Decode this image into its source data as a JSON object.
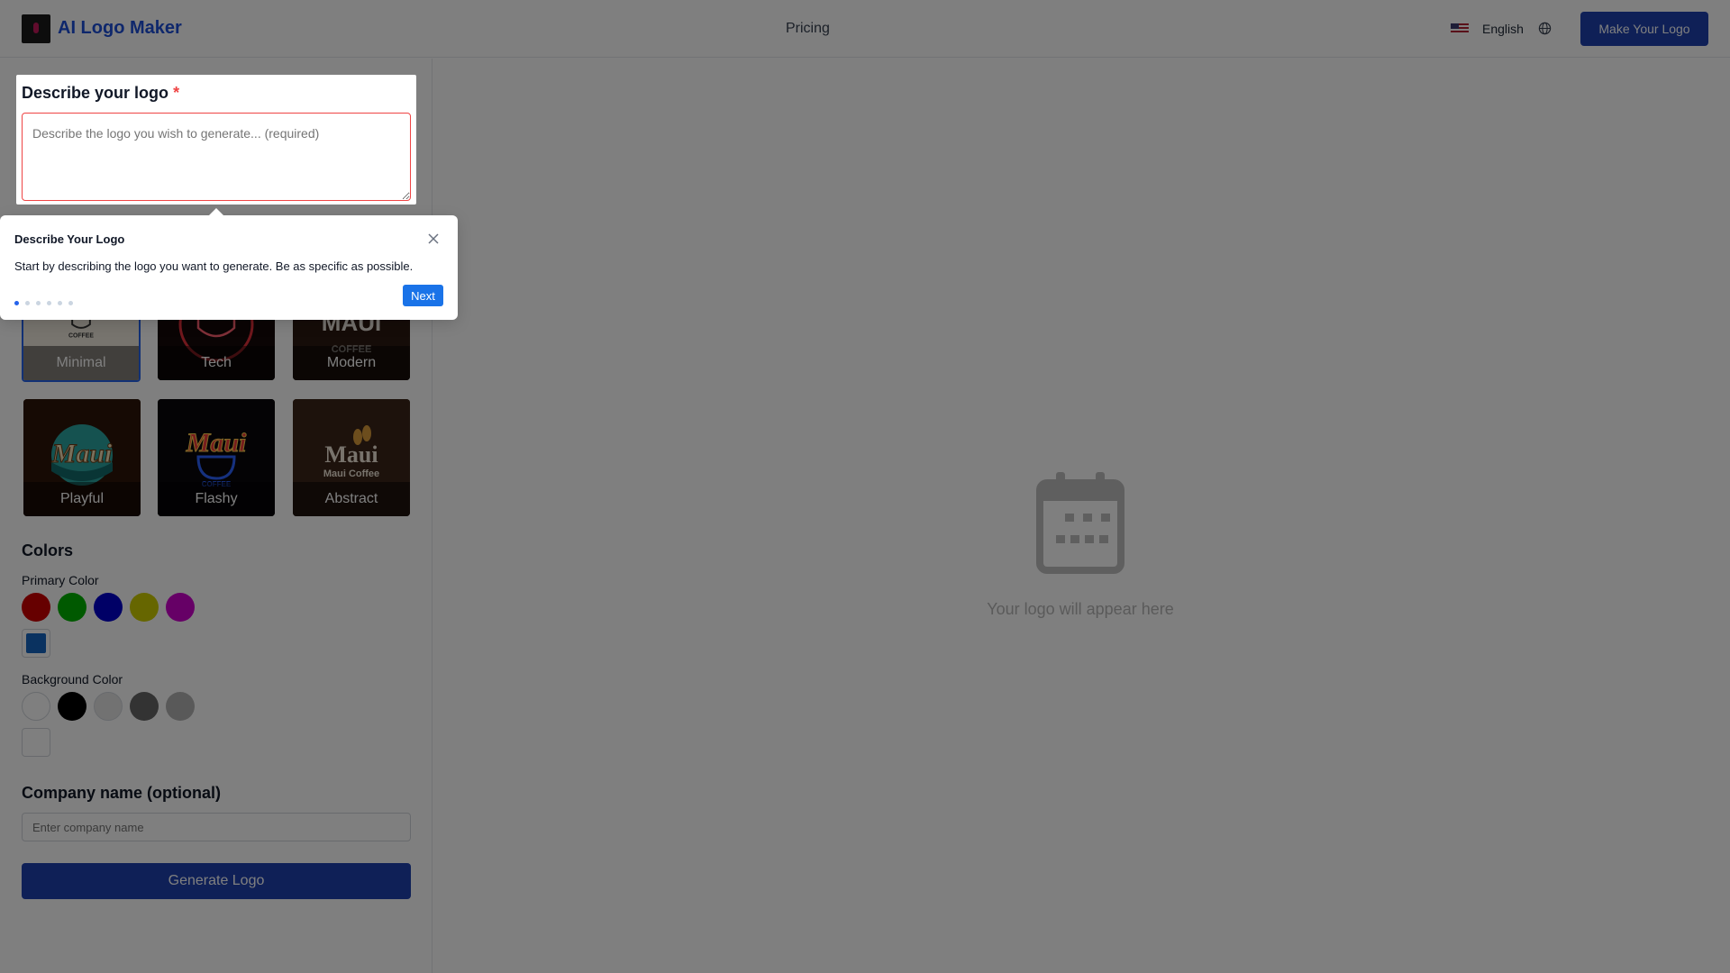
{
  "header": {
    "brand": "AI Logo Maker",
    "nav_pricing": "Pricing",
    "language": "English",
    "make_logo_button": "Make Your Logo"
  },
  "describe": {
    "title": "Describe your logo",
    "required_mark": "*",
    "placeholder": "Describe the logo you wish to generate... (required)"
  },
  "styles": {
    "items": [
      {
        "label": "Minimal",
        "selected": true
      },
      {
        "label": "Tech",
        "selected": false
      },
      {
        "label": "Modern",
        "selected": false
      },
      {
        "label": "Playful",
        "selected": false
      },
      {
        "label": "Flashy",
        "selected": false
      },
      {
        "label": "Abstract",
        "selected": false
      }
    ],
    "art_text": {
      "coffee_small": "COFFEE",
      "maui": "Maui",
      "maui_upper": "MAUI",
      "coffee_upper": "COFFEE",
      "maui_coffee": "Maui Coffee"
    }
  },
  "colors": {
    "title": "Colors",
    "primary_label": "Primary Color",
    "primary_swatches": [
      "#cc0000",
      "#00b300",
      "#0000cc",
      "#cccc00",
      "#cc00cc"
    ],
    "primary_custom": "#1565c0",
    "background_label": "Background Color",
    "background_swatches": [
      "#ffffff",
      "#000000",
      "#e5e5e5",
      "#666666",
      "#b3b3b3"
    ],
    "background_custom": "#ffffff"
  },
  "company": {
    "title": "Company name (optional)",
    "placeholder": "Enter company name"
  },
  "generate_button": "Generate Logo",
  "preview": {
    "placeholder_text": "Your logo will appear here",
    "icon": "calendar-icon"
  },
  "tour": {
    "title": "Describe Your Logo",
    "body": "Start by describing the logo you want to generate. Be as specific as possible.",
    "next_label": "Next",
    "step_current": 1,
    "step_total": 6
  }
}
